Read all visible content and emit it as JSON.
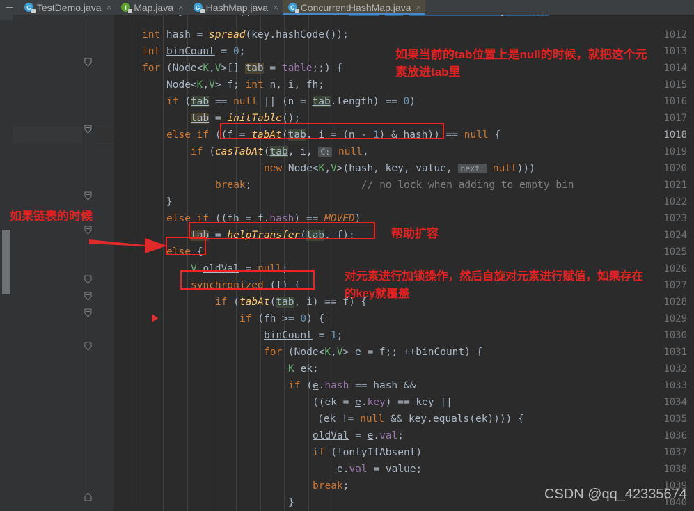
{
  "window": {
    "title": "ConcurrentHashMap.java",
    "theme": "darcula"
  },
  "tabs": [
    {
      "label": "TestDemo.java",
      "icon": "java-class-icon",
      "active": false,
      "close": "×"
    },
    {
      "label": "Map.java",
      "icon": "java-interface-icon",
      "active": false,
      "close": "×"
    },
    {
      "label": "HashMap.java",
      "icon": "java-class-icon",
      "active": false,
      "close": "×"
    },
    {
      "label": "ConcurrentHashMap.java",
      "icon": "java-class-icon",
      "active": true,
      "close": "×"
    }
  ],
  "editor": {
    "first_visible_line": 1011,
    "current_line": 1018,
    "line_numbers": [
      "1012",
      "1013",
      "1014",
      "1015",
      "1016",
      "1017",
      "1018",
      "1019",
      "1020",
      "1021",
      "1022",
      "1023",
      "1024",
      "1025",
      "1026",
      "1027",
      "1028",
      "1029",
      "1030",
      "1031",
      "1032",
      "1033",
      "1034",
      "1035",
      "1036",
      "1037",
      "1038",
      "1039",
      "1040"
    ],
    "top_partial_line": "if (key == null || value == null) throw new NullPointerException();",
    "lines": [
      {
        "n": "1012",
        "text": "        int hash = spread(key.hashCode());"
      },
      {
        "n": "1013",
        "text": "        int binCount = 0;"
      },
      {
        "n": "1014",
        "text": "        for (Node<K,V>[] tab = table;;) {"
      },
      {
        "n": "1015",
        "text": "            Node<K,V> f; int n, i, fh;"
      },
      {
        "n": "1016",
        "text": "            if (tab == null || (n = tab.length) == 0)"
      },
      {
        "n": "1017",
        "text": "                tab = initTable();"
      },
      {
        "n": "1018",
        "text": "            else if ((f = tabAt(tab, i = (n - 1) & hash)) == null) {"
      },
      {
        "n": "1019",
        "text": "                if (casTabAt(tab, i, null,"
      },
      {
        "n": "1020",
        "text": "                         new Node<K,V>(hash, key, value, null)))"
      },
      {
        "n": "1021",
        "text": "                    break;                   // no lock when adding to empty bin"
      },
      {
        "n": "1022",
        "text": "            }"
      },
      {
        "n": "1023",
        "text": "            else if ((fh = f.hash) == MOVED)"
      },
      {
        "n": "1024",
        "text": "                tab = helpTransfer(tab, f);"
      },
      {
        "n": "1025",
        "text": "            else {"
      },
      {
        "n": "1026",
        "text": "                V oldVal = null;"
      },
      {
        "n": "1027",
        "text": "                synchronized (f) {"
      },
      {
        "n": "1028",
        "text": "                    if (tabAt(tab, i) == f) {"
      },
      {
        "n": "1029",
        "text": "                        if (fh >= 0) {"
      },
      {
        "n": "1030",
        "text": "                            binCount = 1;"
      },
      {
        "n": "1031",
        "text": "                            for (Node<K,V> e = f;; ++binCount) {"
      },
      {
        "n": "1032",
        "text": "                                K ek;"
      },
      {
        "n": "1033",
        "text": "                                if (e.hash == hash &&"
      },
      {
        "n": "1034",
        "text": "                                    ((ek = e.key) == key ||"
      },
      {
        "n": "1035",
        "text": "                                     (ek != null && key.equals(ek)))) {"
      },
      {
        "n": "1036",
        "text": "                                    oldVal = e.val;"
      },
      {
        "n": "1037",
        "text": "                                    if (!onlyIfAbsent)"
      },
      {
        "n": "1038",
        "text": "                                        e.val = value;"
      },
      {
        "n": "1039",
        "text": "                                    break;"
      },
      {
        "n": "1040",
        "text": "                                }"
      }
    ],
    "inline_hints": [
      {
        "line": "1019",
        "label": "C:"
      },
      {
        "line": "1020",
        "label": "next:"
      }
    ],
    "comments": [
      {
        "line": "1021",
        "text": "// no lock when adding to empty bin"
      }
    ]
  },
  "annotations": [
    {
      "id": "annotation-null-slot",
      "text": "如果当前的tab位置上是null的时候，就把这个元素\n素放进tab里",
      "line1": "如果当前的tab位置上是null的时候，就把这个元",
      "line2": "素放进tab里",
      "color": "#e42121"
    },
    {
      "id": "annotation-linked-list",
      "text": "如果链表的时候",
      "color": "#e42121"
    },
    {
      "id": "annotation-help-resize",
      "text": "帮助扩容",
      "color": "#e42121"
    },
    {
      "id": "annotation-lock-element",
      "line1": "对元素进行加锁操作，然后自旋对元素进行赋值，如果存在",
      "line2": "的key就覆盖",
      "color": "#e42121"
    }
  ],
  "highlight_boxes": [
    {
      "id": "box-tabat-condition",
      "target_line": "1018"
    },
    {
      "id": "box-help-transfer",
      "target_line": "1024"
    },
    {
      "id": "box-else",
      "target_line": "1025"
    },
    {
      "id": "box-synchronized",
      "target_line": "1027"
    }
  ],
  "markers": {
    "breakpoint_arrow_line": "1029",
    "red_arrow_points_to": "else {"
  },
  "watermark": {
    "text": "CSDN @qq_42335674"
  }
}
